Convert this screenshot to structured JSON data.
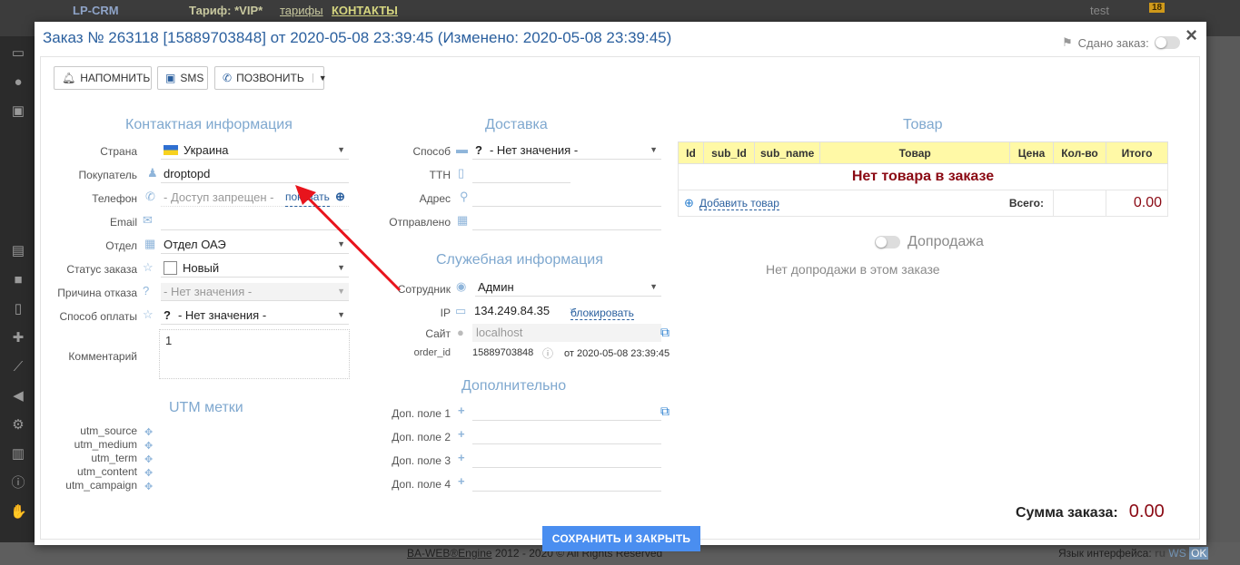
{
  "background": {
    "logo": "LP-CRM",
    "tariff_label": "Тариф: *VIP*",
    "tariffs_link": "тарифы",
    "contacts_link": "КОНТАКТЫ",
    "user": "test",
    "badge": "18",
    "footer_left": "BA-WEB®Engine",
    "footer_copy": "2012 - 2020 © All Rights Reserved",
    "footer_lang": "Язык интерфейса:",
    "footer_lang_code": "ru",
    "footer_ws": "WS",
    "footer_ok": "OK"
  },
  "modal": {
    "title": "Заказ № 263118 [15889703848] от 2020-05-08 23:39:45 (Изменено: 2020-05-08 23:39:45)",
    "done_label": "Сдано заказ:",
    "close": "×"
  },
  "toolbar": {
    "remind": "НАПОМНИТЬ",
    "sms": "SMS",
    "call": "ПОЗВОНИТЬ"
  },
  "contact": {
    "title": "Контактная информация",
    "country_label": "Страна",
    "country_value": "Украина",
    "buyer_label": "Покупатель",
    "buyer_value": "droptopd",
    "phone_label": "Телефон",
    "phone_value": "- Доступ запрещен -",
    "phone_show": "показать",
    "email_label": "Email",
    "email_value": "",
    "dept_label": "Отдел",
    "dept_value": "Отдел ОАЭ",
    "status_label": "Статус заказа",
    "status_value": "Новый",
    "reason_label": "Причина отказа",
    "reason_value": "- Нет значения -",
    "payment_label": "Способ оплаты",
    "payment_value": "- Нет значения -",
    "comment_label": "Комментарий",
    "comment_value": "1"
  },
  "utm": {
    "title": "UTM метки",
    "labels": [
      "utm_source",
      "utm_medium",
      "utm_term",
      "utm_content",
      "utm_campaign"
    ]
  },
  "delivery": {
    "title": "Доставка",
    "method_label": "Способ",
    "method_value": "- Нет значения -",
    "ttn_label": "ТТН",
    "address_label": "Адрес",
    "sent_label": "Отправлено"
  },
  "service": {
    "title": "Служебная информация",
    "employee_label": "Сотрудник",
    "employee_value": "Админ",
    "ip_label": "IP",
    "ip_value": "134.249.84.35",
    "block_link": "блокировать",
    "site_label": "Сайт",
    "site_value": "localhost",
    "order_id_label": "order_id",
    "order_id_value": "15889703848",
    "order_id_date": "от 2020-05-08 23:39:45"
  },
  "extra": {
    "title": "Дополнительно",
    "fields": [
      "Доп. поле 1",
      "Доп. поле 2",
      "Доп. поле 3",
      "Доп. поле 4"
    ]
  },
  "goods": {
    "title": "Товар",
    "columns": [
      "Id",
      "sub_Id",
      "sub_name",
      "Товар",
      "Цена",
      "Кол-во",
      "Итого"
    ],
    "empty": "Нет товара в заказе",
    "add": "Добавить товар",
    "total_label": "Всего:",
    "total_value": "0.00"
  },
  "upsell": {
    "title": "Допродажа",
    "note": "Нет допродажи в этом заказе"
  },
  "summary": {
    "label": "Сумма заказа:",
    "value": "0.00"
  },
  "save_button": "СОХРАНИТЬ И ЗАКРЫТЬ",
  "colors": {
    "accent": "#2a5f9e",
    "section_title": "#7fa8cf",
    "total_red": "#8b0a14",
    "table_header": "#fff9a6",
    "save_button": "#4a8ef0",
    "arrow": "#e8141c"
  }
}
